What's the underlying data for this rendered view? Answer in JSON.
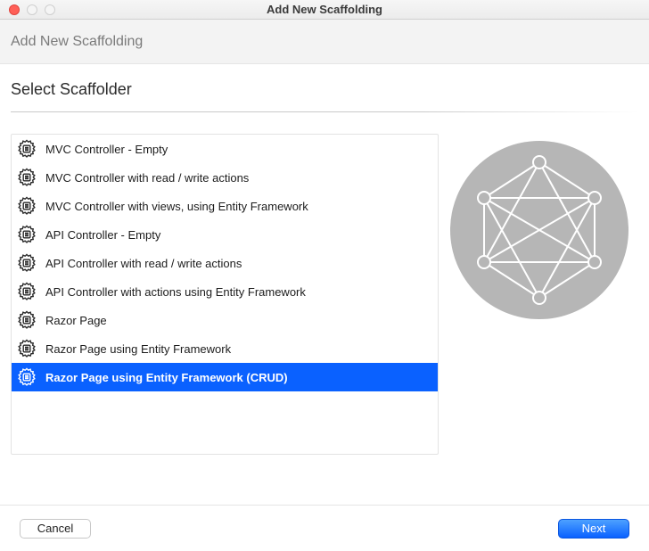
{
  "window": {
    "title": "Add New Scaffolding"
  },
  "subheader": {
    "title": "Add New Scaffolding"
  },
  "section": {
    "title": "Select Scaffolder"
  },
  "scaffolders": [
    {
      "label": "MVC Controller - Empty",
      "selected": false
    },
    {
      "label": "MVC Controller with read / write actions",
      "selected": false
    },
    {
      "label": "MVC Controller with views, using Entity Framework",
      "selected": false
    },
    {
      "label": "API Controller - Empty",
      "selected": false
    },
    {
      "label": "API Controller with read / write actions",
      "selected": false
    },
    {
      "label": "API Controller with actions using Entity Framework",
      "selected": false
    },
    {
      "label": "Razor Page",
      "selected": false
    },
    {
      "label": "Razor Page using Entity Framework",
      "selected": false
    },
    {
      "label": "Razor Page using Entity Framework (CRUD)",
      "selected": true
    }
  ],
  "footer": {
    "cancel": "Cancel",
    "next": "Next"
  }
}
